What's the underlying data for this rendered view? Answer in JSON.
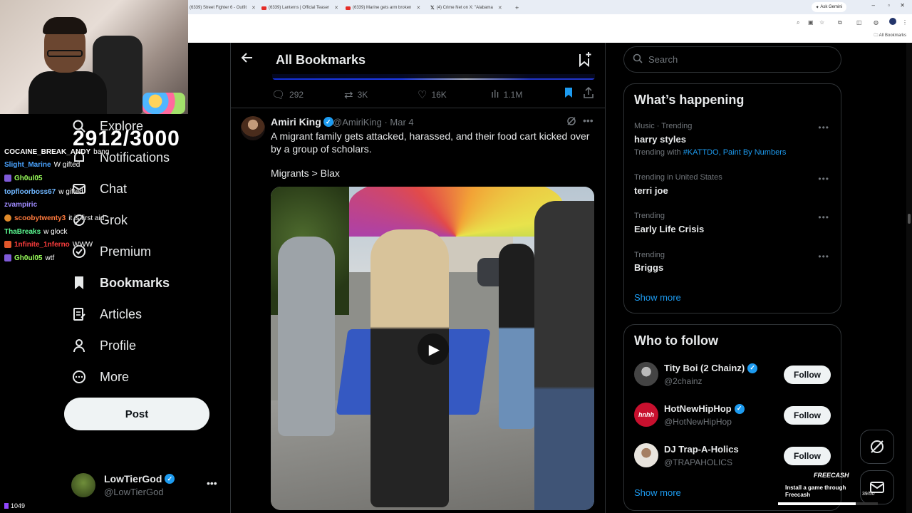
{
  "browser": {
    "tabs": [
      {
        "label": "(6339) Street Fighter 6 - Outfit"
      },
      {
        "label": "(6339) Lanterns | Official Teaser"
      },
      {
        "label": "(6339) Marine gets arm broken"
      },
      {
        "label": "(4) Crime Net on X: \"Alabama"
      }
    ],
    "new_tab": "+",
    "ask_gemini": "Ask Gemini",
    "bookmarks_folder": "All Bookmarks"
  },
  "overlay": {
    "sub_counter": "2912/3000",
    "viewer_count": "1049",
    "chat": [
      {
        "user": "COCAINE_BREAK_ANDY",
        "message": "bang",
        "color": "#ffffff",
        "badge": "#6f3fbf"
      },
      {
        "user": "Slight_Marine",
        "message": "W gifted",
        "color": "#4aa3ff",
        "badge": ""
      },
      {
        "user": "Gh0ul05",
        "message": "",
        "color": "#9aff5b",
        "badge": "#7f5ad8"
      },
      {
        "user": "topfloorboss67",
        "message": "w gifted",
        "color": "#6fb6ff",
        "badge": ""
      },
      {
        "user": "zvampiric",
        "message": "",
        "color": "#9f8bff",
        "badge": ""
      },
      {
        "user": "scoobytwenty3",
        "message": "it is first aid",
        "color": "#ff7a3d",
        "badge": "#e08a2a"
      },
      {
        "user": "ThaBreaks",
        "message": "w glock",
        "color": "#5dff95",
        "badge": ""
      },
      {
        "user": "1nfinite_1nferno",
        "message": "WWW",
        "color": "#ff3d3d",
        "badge": "#e2572b"
      },
      {
        "user": "Gh0ul05",
        "message": "wtf",
        "color": "#9aff5b",
        "badge": "#7f5ad8"
      }
    ]
  },
  "sidebar": {
    "items": [
      {
        "label": "Explore",
        "icon": "search-icon"
      },
      {
        "label": "Notifications",
        "icon": "bell-icon"
      },
      {
        "label": "Chat",
        "icon": "mail-icon"
      },
      {
        "label": "Grok",
        "icon": "grok-icon"
      },
      {
        "label": "Premium",
        "icon": "premium-icon"
      },
      {
        "label": "Bookmarks",
        "icon": "bookmark-icon"
      },
      {
        "label": "Articles",
        "icon": "articles-icon"
      },
      {
        "label": "Profile",
        "icon": "person-icon"
      },
      {
        "label": "More",
        "icon": "more-circle-icon"
      }
    ],
    "post_label": "Post",
    "account": {
      "name": "LowTierGod",
      "handle": "@LowTierGod"
    }
  },
  "main": {
    "title": "All Bookmarks",
    "prev_tweet_stats": {
      "replies": "292",
      "reposts": "3K",
      "likes": "16K",
      "views": "1.1M"
    },
    "tweet": {
      "name": "Amiri King",
      "handle": "@AmiriKing",
      "date": "Mar 4",
      "text_line1": "A migrant family gets attacked, harassed, and their food cart kicked over by a group of scholars.",
      "text_line2": "Migrants > Blax"
    }
  },
  "right": {
    "search_placeholder": "Search",
    "happening_title": "What’s happening",
    "trends": [
      {
        "context": "Music · Trending",
        "name": "harry styles",
        "sub_prefix": "Trending with ",
        "sub_tags": "#KATTDO, Paint By Numbers"
      },
      {
        "context": "Trending in United States",
        "name": "terri joe",
        "sub_prefix": "",
        "sub_tags": ""
      },
      {
        "context": "Trending",
        "name": "Early Life Crisis",
        "sub_prefix": "",
        "sub_tags": ""
      },
      {
        "context": "Trending",
        "name": "Briggs",
        "sub_prefix": "",
        "sub_tags": ""
      }
    ],
    "trends_show_more": "Show more",
    "follow_title": "Who to follow",
    "follow": [
      {
        "name": "Tity Boi (2 Chainz)",
        "handle": "@2chainz",
        "button": "Follow"
      },
      {
        "name": "HotNewHipHop",
        "handle": "@HotNewHipHop",
        "button": "Follow",
        "avatar_text": "hnhh"
      },
      {
        "name": "DJ Trap-A-Holics",
        "handle": "@TRAPAHOLICS",
        "button": "Follow"
      }
    ],
    "follow_show_more": "Show more"
  },
  "freecash": {
    "logo": "FREECASH",
    "text": "Install a game through Freecash",
    "count": "39/50",
    "progress": 0.78
  },
  "colors": {
    "accent": "#1d9bf0",
    "background": "#000000",
    "divider": "#2f3336"
  }
}
